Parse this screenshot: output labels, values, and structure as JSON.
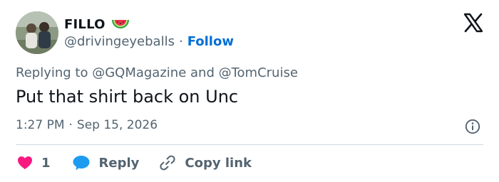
{
  "author": {
    "display_name": "FILLO",
    "name_emoji": "watermelon-slice",
    "handle": "@drivingeyeballs",
    "separator": "·",
    "follow_label": "Follow"
  },
  "reply_context": {
    "prefix": "Replying to ",
    "mention_1": "@GQMagazine",
    "joiner": " and ",
    "mention_2": "@TomCruise"
  },
  "tweet": {
    "text": "Put that shirt back on Unc",
    "time": "1:27 PM",
    "separator": "·",
    "date": "Sep 15, 2026"
  },
  "actions": {
    "like_count": "1",
    "reply_label": "Reply",
    "copy_link_label": "Copy link"
  },
  "icons": {
    "logo": "x-logo-icon",
    "info": "info-icon",
    "like": "heart-icon",
    "reply": "speech-bubble-icon",
    "copy": "link-icon"
  },
  "colors": {
    "text_primary": "#0f1419",
    "text_secondary": "#536471",
    "follow_blue": "#006fd6",
    "heart_pink": "#f91880",
    "reply_blue": "#1d9bf0",
    "divider": "#cfd9de"
  }
}
